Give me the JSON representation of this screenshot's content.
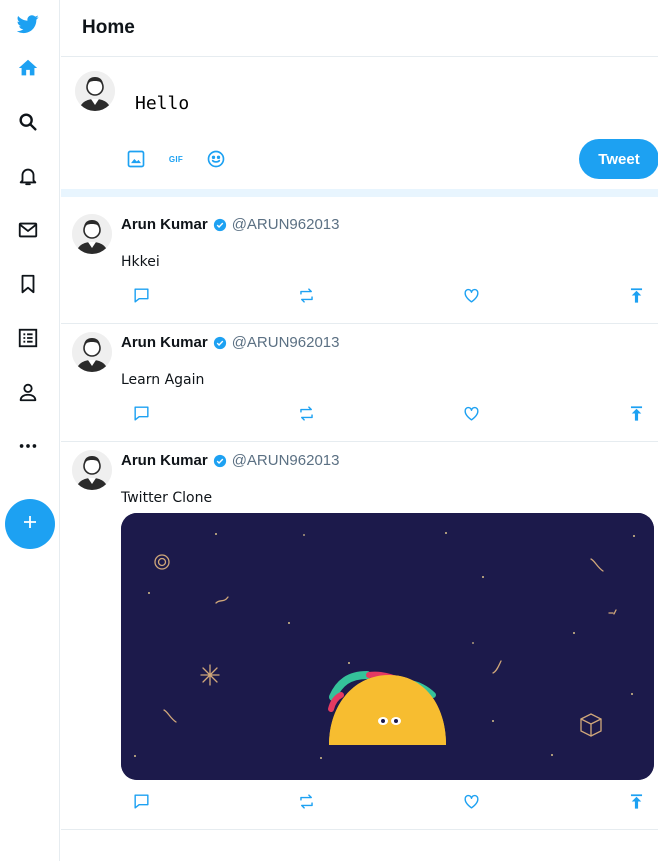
{
  "app": {
    "name": "Twitter Clone"
  },
  "colors": {
    "accent": "#1da1f2",
    "divider": "#e6ecf0",
    "media_bg": "#1c1a4b"
  },
  "sidebar": {
    "items": [
      {
        "icon": "twitter-logo-icon"
      },
      {
        "icon": "home-icon"
      },
      {
        "icon": "search-icon"
      },
      {
        "icon": "bell-icon"
      },
      {
        "icon": "mail-icon"
      },
      {
        "icon": "bookmark-icon"
      },
      {
        "icon": "list-icon"
      },
      {
        "icon": "profile-icon"
      },
      {
        "icon": "more-icon"
      }
    ],
    "fab_icon": "plus-icon"
  },
  "header": {
    "title": "Home"
  },
  "compose": {
    "input_value": "Hello",
    "tools": [
      {
        "icon": "image-icon"
      },
      {
        "icon": "gif-icon",
        "label": "GIF"
      },
      {
        "icon": "emoji-icon"
      }
    ],
    "tweet_label": "Tweet"
  },
  "posts": [
    {
      "name": "Arun Kumar",
      "handle": "@ARUN962013",
      "text": "Hkkei",
      "has_media": false
    },
    {
      "name": "Arun Kumar",
      "handle": "@ARUN962013",
      "text": "Learn Again",
      "has_media": false
    },
    {
      "name": "Arun Kumar",
      "handle": "@ARUN962013",
      "text": "Twitter Clone",
      "has_media": true,
      "media": "taco-gif"
    }
  ],
  "post_actions": [
    {
      "icon": "reply-icon"
    },
    {
      "icon": "retweet-icon"
    },
    {
      "icon": "like-icon"
    },
    {
      "icon": "share-icon"
    }
  ]
}
